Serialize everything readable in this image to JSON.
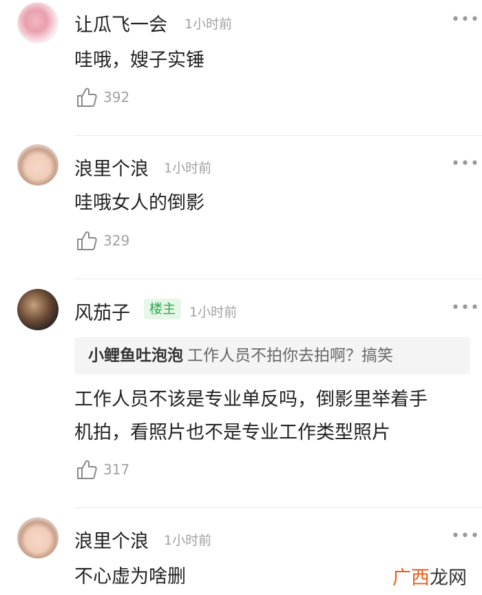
{
  "comments": [
    {
      "username": "让瓜飞一会",
      "time": "1小时前",
      "text": "哇哦，嫂子实锤",
      "likes": "392"
    },
    {
      "username": "浪里个浪",
      "time": "1小时前",
      "text": "哇哦女人的倒影",
      "likes": "329"
    },
    {
      "username": "风茄子",
      "badge": "楼主",
      "time": "1小时前",
      "quote": {
        "user": "小鲤鱼吐泡泡",
        "text": "工作人员不拍你去拍啊？搞笑"
      },
      "text_line1": "工作人员不该是专业单反吗，倒影里举着手",
      "text_line2": "机拍，看照片也不是专业工作类型照片",
      "likes": "317"
    },
    {
      "username": "浪里个浪",
      "time": "1小时前",
      "text": "不心虚为啥删"
    }
  ],
  "more_glyph": "•••",
  "watermark": {
    "part1": "广西",
    "part2": "龙网"
  },
  "icons": {
    "like": "thumbs-up-icon",
    "more": "more-dots-icon"
  },
  "colors": {
    "badge_bg": "#e6f7e9",
    "badge_text": "#2faa4d",
    "time": "#a0a0a0",
    "watermark_orange": "#e85d17"
  }
}
